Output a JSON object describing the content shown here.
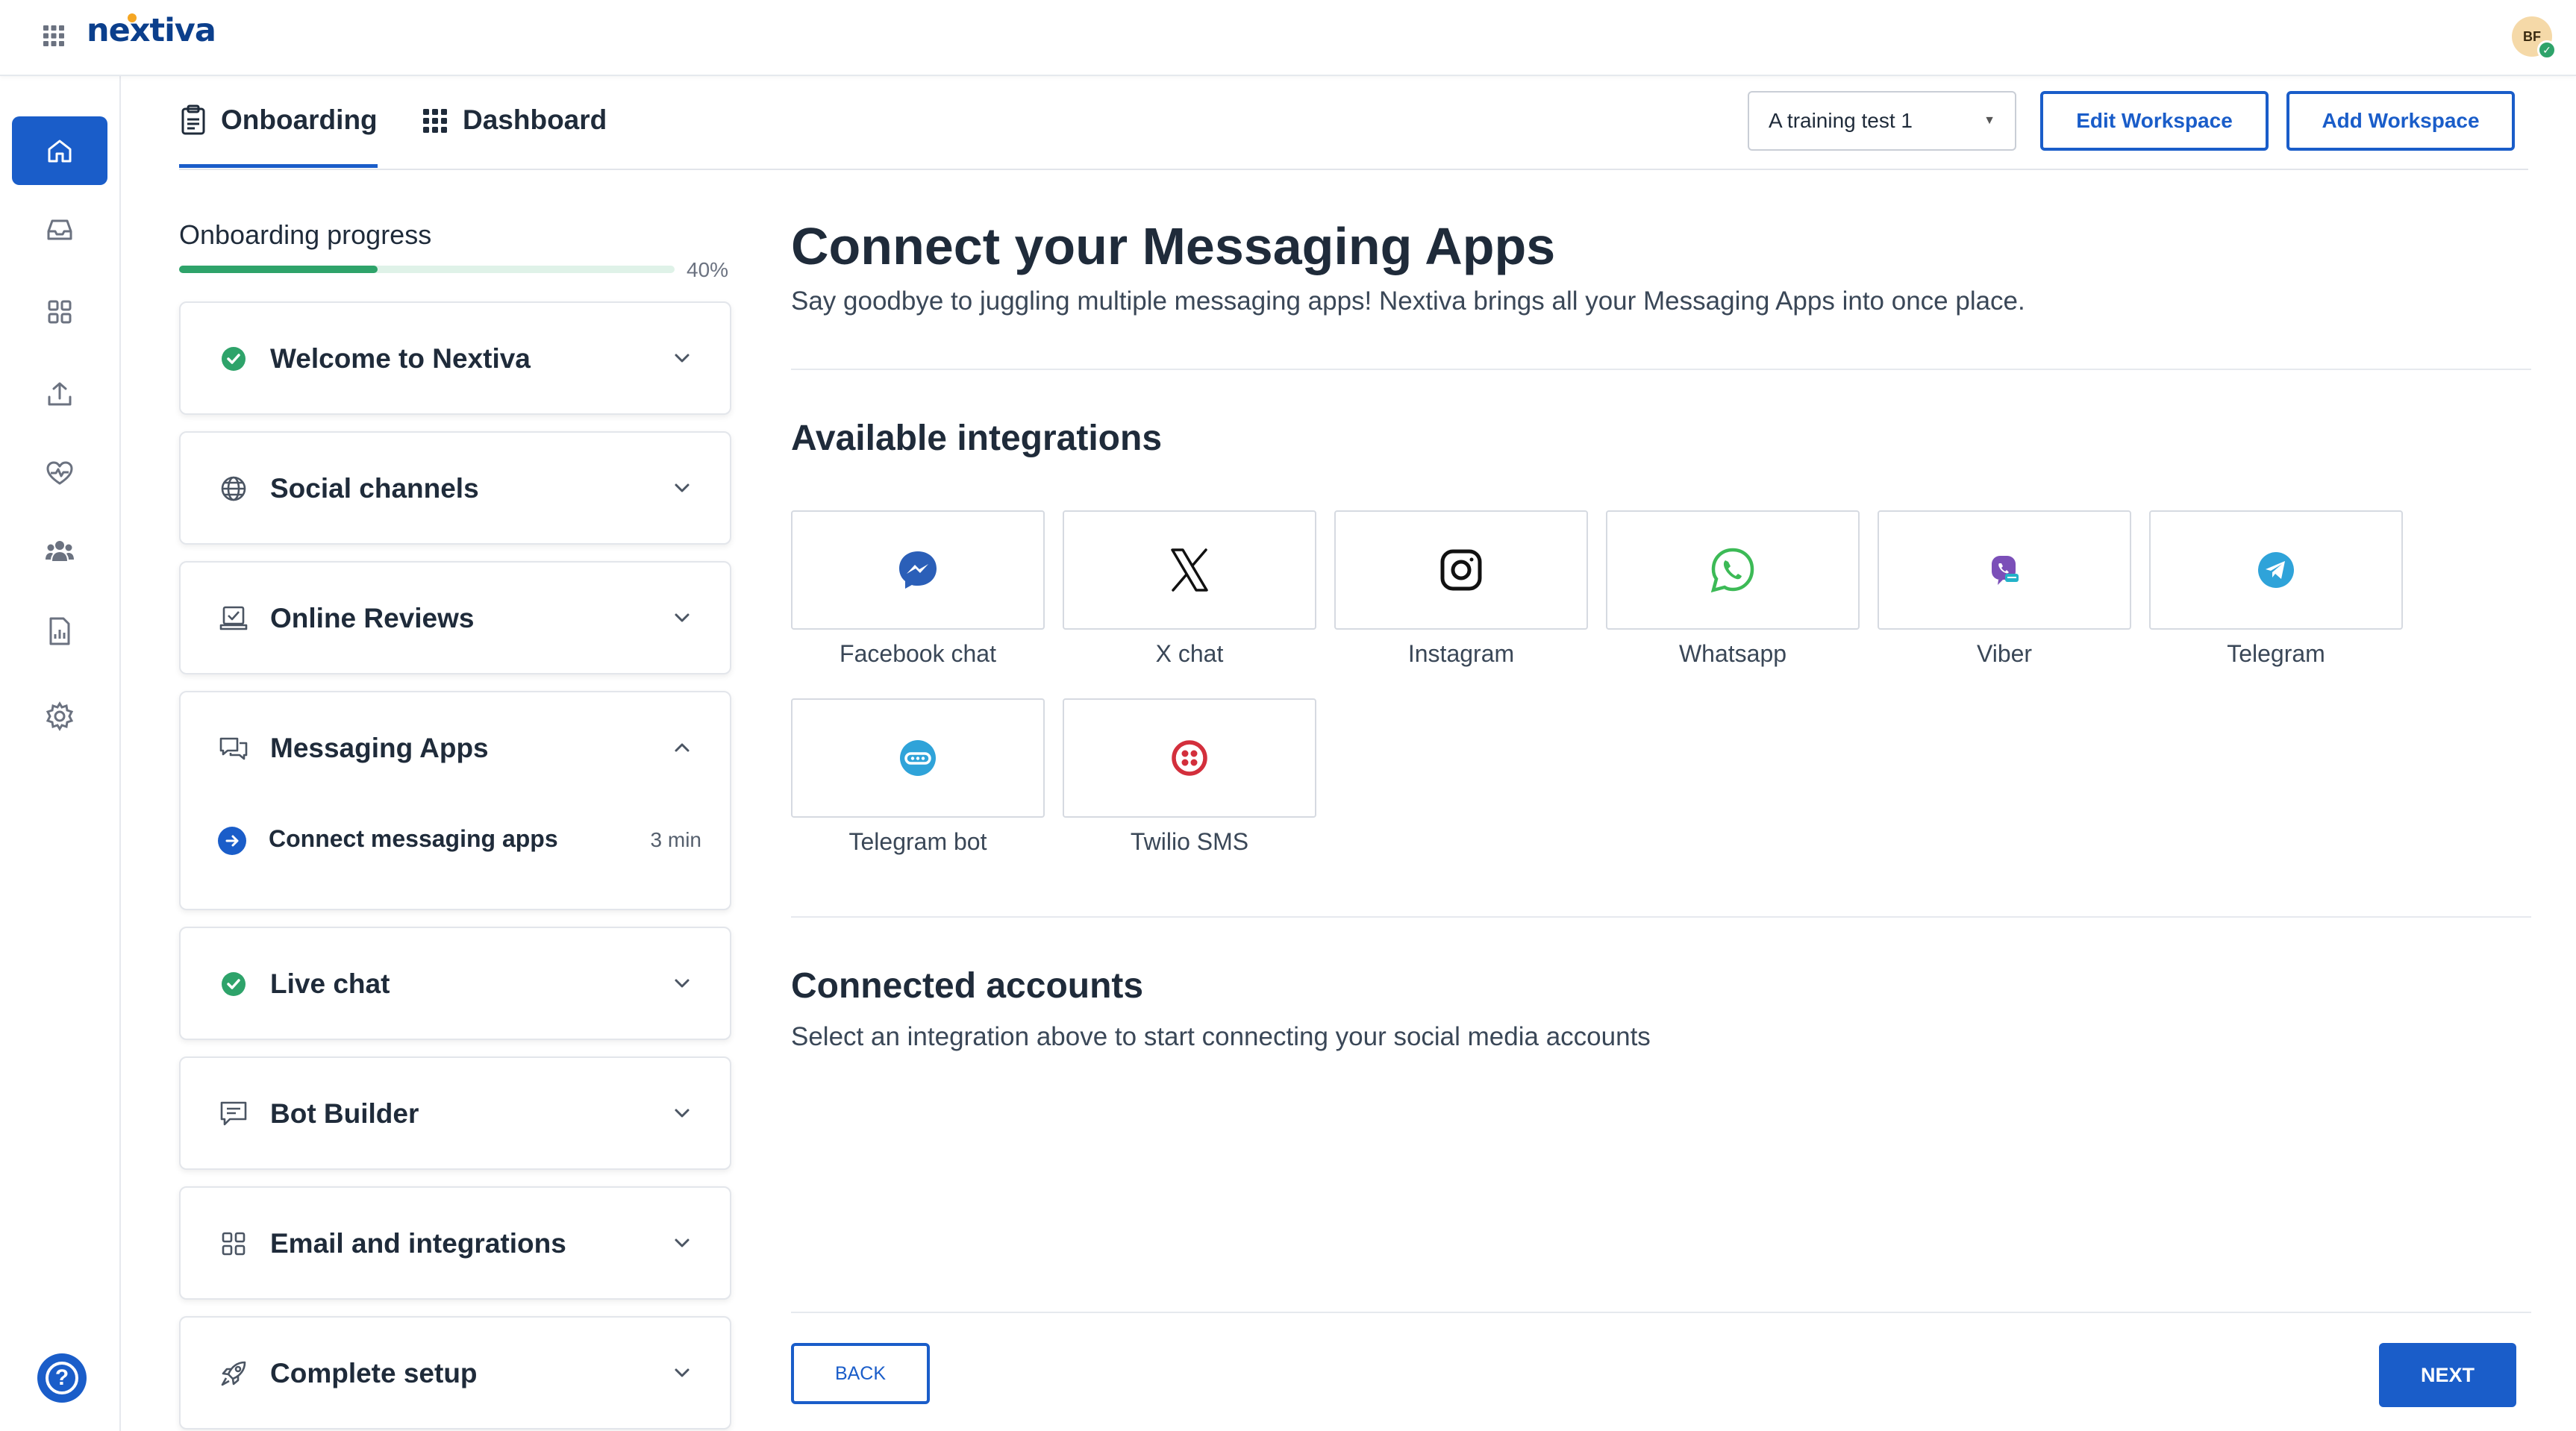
{
  "header": {
    "logo_text": "nextiva",
    "avatar_initials": "BF",
    "app_grid_icon": "app-grid-icon",
    "brand_color": "#0b3f8c",
    "accent_color": "#1a5dc9"
  },
  "rail": {
    "items": [
      {
        "name": "home-icon",
        "active": true
      },
      {
        "name": "inbox-icon"
      },
      {
        "name": "apps-grid-icon"
      },
      {
        "name": "upload-icon"
      },
      {
        "name": "heart-pulse-icon"
      },
      {
        "name": "contacts-icon"
      },
      {
        "name": "report-icon"
      },
      {
        "name": "gear-icon"
      }
    ],
    "help_glyph": "?"
  },
  "tabs": [
    {
      "label": "Onboarding",
      "icon": "clipboard-icon",
      "active": true
    },
    {
      "label": "Dashboard",
      "icon": "grid-dots-icon"
    }
  ],
  "workspace": {
    "selected": "A training test 1",
    "edit_label": "Edit Workspace",
    "add_label": "Add Workspace"
  },
  "progress": {
    "label": "Onboarding progress",
    "value": 0.4,
    "text": "40%"
  },
  "steps": [
    {
      "title": "Welcome to Nextiva",
      "icon": "check-circle-icon",
      "expanded": false
    },
    {
      "title": "Social channels",
      "icon": "globe-icon",
      "expanded": false
    },
    {
      "title": "Online Reviews",
      "icon": "review-icon",
      "expanded": false
    },
    {
      "title": "Messaging Apps",
      "icon": "chat-bubbles-icon",
      "expanded": true,
      "sub": {
        "label": "Connect messaging apps",
        "time": "3 min",
        "icon": "arrow-right-circle-icon"
      }
    },
    {
      "title": "Live chat",
      "icon": "check-circle-icon",
      "expanded": false
    },
    {
      "title": "Bot Builder",
      "icon": "message-square-icon",
      "expanded": false
    },
    {
      "title": "Email and integrations",
      "icon": "squares-icon",
      "expanded": false
    },
    {
      "title": "Complete setup",
      "icon": "rocket-icon",
      "expanded": false
    }
  ],
  "main": {
    "title": "Connect your Messaging Apps",
    "subtitle": "Say goodbye to juggling multiple messaging apps! Nextiva brings all your Messaging Apps into once place.",
    "available_title": "Available integrations",
    "integrations": [
      {
        "label": "Facebook chat",
        "icon": "messenger-icon"
      },
      {
        "label": "X chat",
        "icon": "x-logo-icon"
      },
      {
        "label": "Instagram",
        "icon": "instagram-icon"
      },
      {
        "label": "Whatsapp",
        "icon": "whatsapp-icon"
      },
      {
        "label": "Viber",
        "icon": "viber-icon"
      },
      {
        "label": "Telegram",
        "icon": "telegram-icon"
      },
      {
        "label": "Telegram bot",
        "icon": "telegram-bot-icon"
      },
      {
        "label": "Twilio SMS",
        "icon": "twilio-icon"
      }
    ],
    "connected_title": "Connected accounts",
    "connected_text": "Select an integration above to start connecting your social media accounts"
  },
  "footer": {
    "back_label": "BACK",
    "next_label": "NEXT"
  }
}
